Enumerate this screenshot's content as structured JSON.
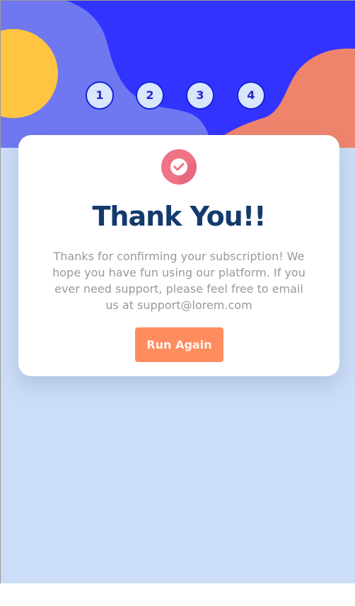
{
  "stepper": {
    "steps": [
      "1",
      "2",
      "3",
      "4"
    ]
  },
  "confirmation": {
    "title": "Thank You!!",
    "message": "Thanks for confirming your subscription! We hope you have fun using our platform. If you ever need support, please feel free to email us at support@lorem.com",
    "button_label": "Run Again"
  },
  "icons": {
    "success": "check-circle-icon"
  },
  "colors": {
    "background": "#cbddf7",
    "hero_blue": "#3333ff",
    "hero_soft_blue": "#6f78f0",
    "sun": "#ffc441",
    "coral": "#ef846d",
    "title": "#143a6d",
    "button": "#ff8c5f",
    "step_border": "#1122dd"
  }
}
